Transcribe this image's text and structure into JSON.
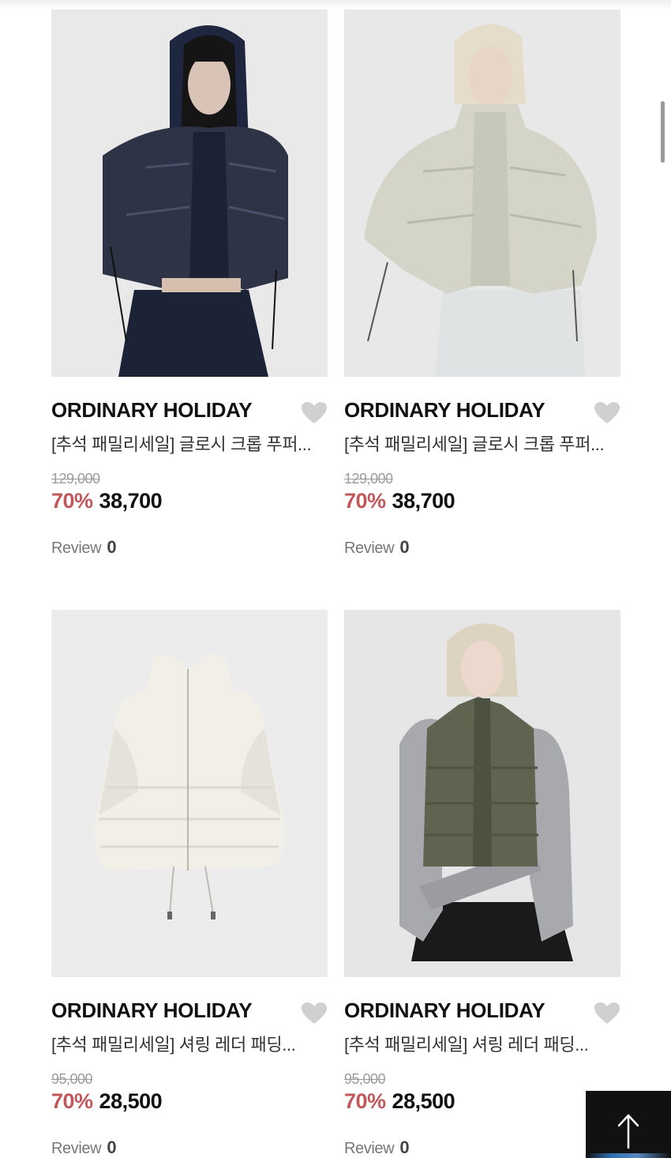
{
  "products": [
    {
      "brand": "ORDINARY HOLIDAY",
      "title": "[추석 패밀리세일] 글로시 크롭 푸퍼...",
      "original_price": "129,000",
      "discount": "70%",
      "sale_price": "38,700",
      "review_label": "Review",
      "review_count": "0"
    },
    {
      "brand": "ORDINARY HOLIDAY",
      "title": "[추석 패밀리세일] 글로시 크롭 푸퍼...",
      "original_price": "129,000",
      "discount": "70%",
      "sale_price": "38,700",
      "review_label": "Review",
      "review_count": "0"
    },
    {
      "brand": "ORDINARY HOLIDAY",
      "title": "[추석 패밀리세일] 셔링 레더 패딩...",
      "original_price": "95,000",
      "discount": "70%",
      "sale_price": "28,500",
      "review_label": "Review",
      "review_count": "0"
    },
    {
      "brand": "ORDINARY HOLIDAY",
      "title": "[추석 패밀리세일] 셔링 레더 패딩...",
      "original_price": "95,000",
      "discount": "70%",
      "sale_price": "28,500",
      "review_label": "Review",
      "review_count": "0"
    }
  ],
  "icons": {
    "wishlist": "heart-icon",
    "scroll_top": "arrow-up-icon"
  },
  "colors": {
    "discount": "#c2575b",
    "heart": "#d0d0d0",
    "scroll_top_bg": "#111111"
  }
}
